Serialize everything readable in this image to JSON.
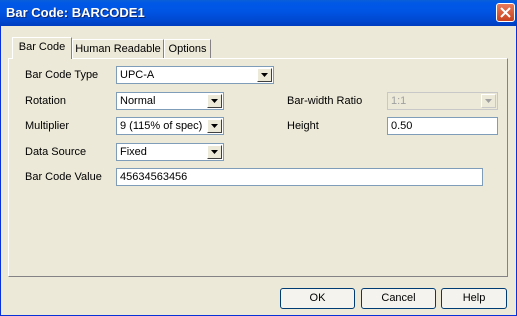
{
  "window": {
    "title": "Bar Code: BARCODE1"
  },
  "tabs": [
    {
      "label": "Bar Code"
    },
    {
      "label": "Human Readable"
    },
    {
      "label": "Options"
    }
  ],
  "form": {
    "bar_code_type": {
      "label": "Bar Code Type",
      "value": "UPC-A"
    },
    "rotation": {
      "label": "Rotation",
      "value": "Normal"
    },
    "multiplier": {
      "label": "Multiplier",
      "value": "9 (115% of spec)"
    },
    "data_source": {
      "label": "Data Source",
      "value": "Fixed"
    },
    "bar_code_value": {
      "label": "Bar Code Value",
      "value": "45634563456"
    },
    "bar_width_ratio": {
      "label": "Bar-width Ratio",
      "value": "1:1"
    },
    "height": {
      "label": "Height",
      "value": "0.50"
    }
  },
  "buttons": {
    "ok": "OK",
    "cancel": "Cancel",
    "help": "Help"
  },
  "icons": {
    "close": "close-icon",
    "dropdown": "chevron-down-icon"
  }
}
